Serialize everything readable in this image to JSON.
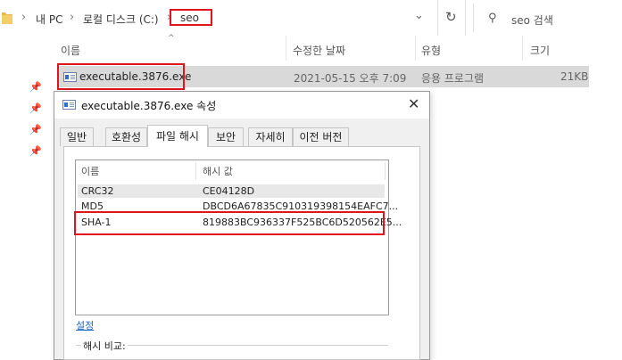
{
  "explorer": {
    "breadcrumb": [
      "내 PC",
      "로컬 디스크 (C:)",
      "seo"
    ],
    "search_placeholder": "seo 검색",
    "columns": [
      "이름",
      "수정한 날짜",
      "유형",
      "크기"
    ],
    "file": {
      "name": "executable.3876.exe",
      "modified": "2021-05-15 오후 7:09",
      "type": "응용 프로그램",
      "size": "21KB"
    }
  },
  "dialog": {
    "title": "executable.3876.exe 속성",
    "tabs": [
      "일반",
      "호환성",
      "파일 해시",
      "보안",
      "자세히",
      "이전 버전"
    ],
    "active_tab": "파일 해시",
    "list_headers": [
      "이름",
      "해시 값"
    ],
    "hashes": [
      {
        "name": "CRC32",
        "value": "CE04128D"
      },
      {
        "name": "MD5",
        "value": "DBCD6A67835C910319398154EAFC7..."
      },
      {
        "name": "SHA-1",
        "value": "819883BC936337F525BC6D520562E5..."
      }
    ],
    "settings_link": "설정",
    "compare_label": "해시 비교:"
  },
  "colors": {
    "highlight_box": "#e0141e",
    "selected_row": "#d9d9d9",
    "link": "#1a66c4"
  }
}
